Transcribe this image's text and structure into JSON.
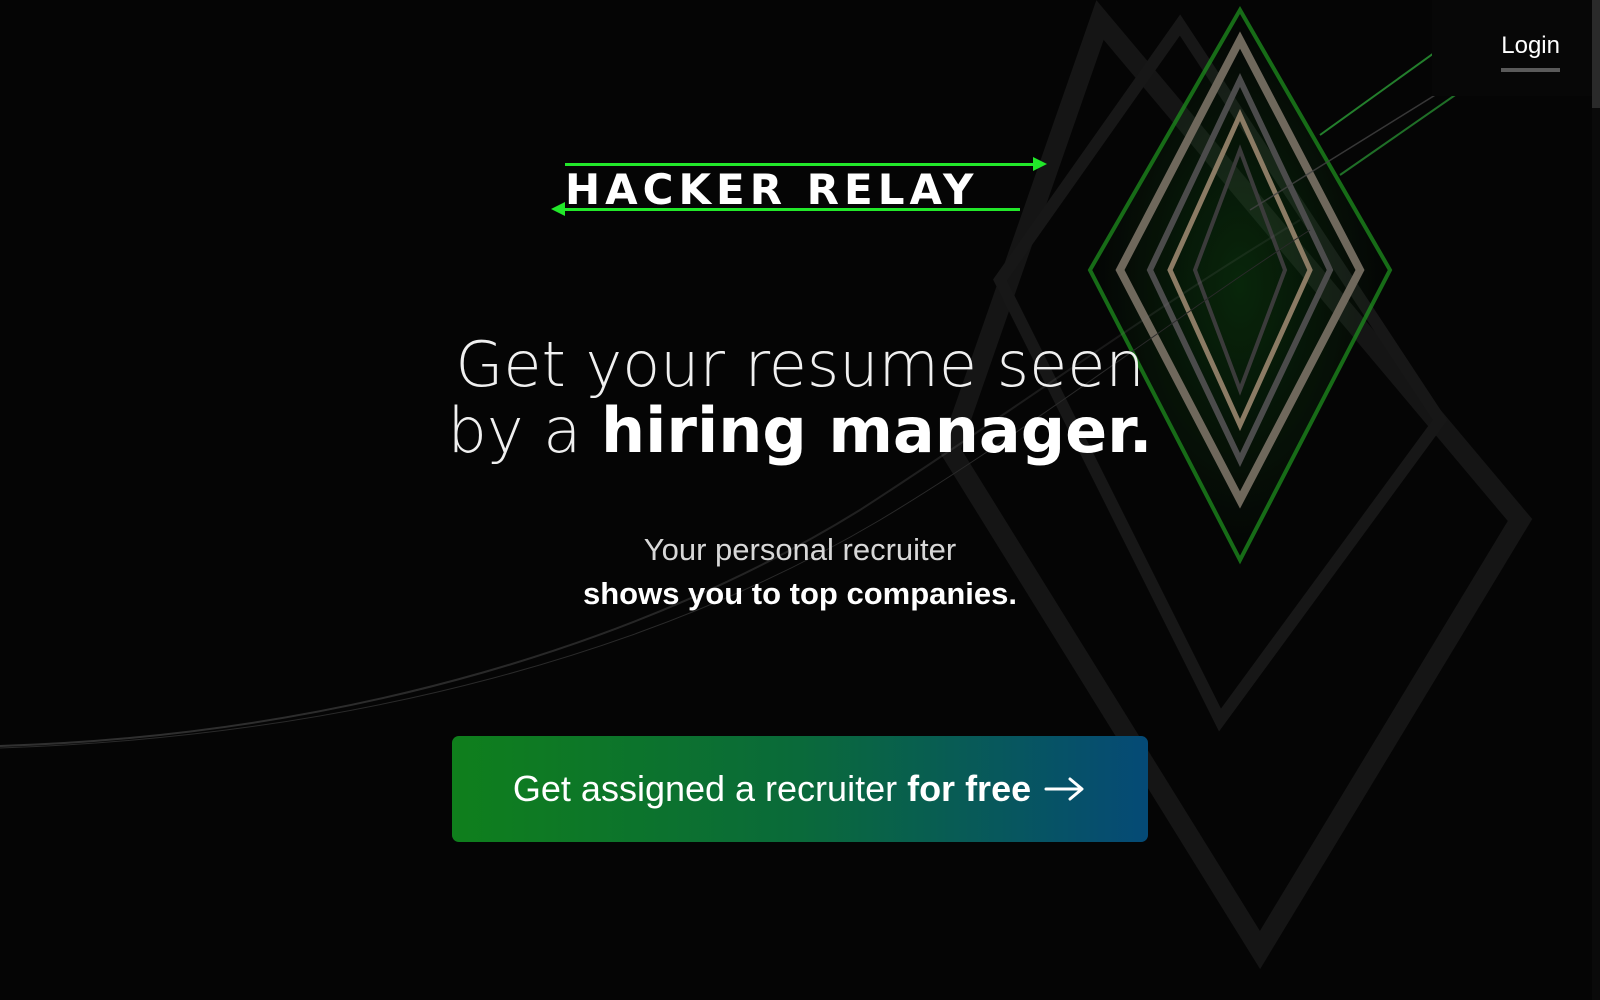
{
  "header": {
    "login_label": "Login"
  },
  "logo": {
    "text": "HACKER RELAY",
    "accent_color": "#22e82a",
    "icon": "double-arrow-logo-icon"
  },
  "hero": {
    "headline_line1": "Get your resume seen",
    "headline_line2_normal": "by a",
    "headline_line2_bold": "hiring manager.",
    "subheadline_line1": "Your personal recruiter",
    "subheadline_line2": "shows you to top companies."
  },
  "cta": {
    "label_normal": "Get assigned a recruiter",
    "label_bold": "for free",
    "icon": "arrow-right-icon",
    "gradient_start": "#0f7f1c",
    "gradient_end": "#054a76"
  },
  "colors": {
    "background": "#050505",
    "text": "#ffffff",
    "accent_green": "#22e82a"
  }
}
